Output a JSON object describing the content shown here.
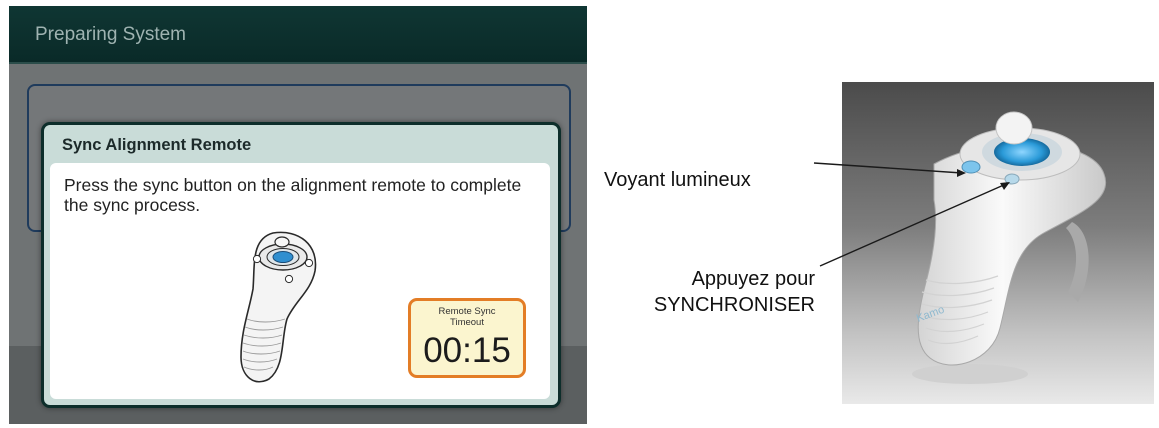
{
  "screen": {
    "title": "Preparing System"
  },
  "dialog": {
    "title": "Sync Alignment Remote",
    "message": "Press the sync button on the alignment remote to complete the sync process.",
    "timer": {
      "label_line1": "Remote Sync",
      "label_line2": "Timeout",
      "value": "00:15"
    }
  },
  "photo": {
    "brand_text": "Kamo"
  },
  "callouts": {
    "indicator_light": "Voyant lumineux",
    "press_line1": "Appuyez pour",
    "press_line2": "SYNCHRONISER"
  },
  "colors": {
    "titlebar": "#0f3633",
    "dialog_header": "#c9dcd8",
    "timer_border": "#e37d26",
    "timer_fill": "#fbf5cf",
    "remote_button": "#2f8fd0"
  }
}
